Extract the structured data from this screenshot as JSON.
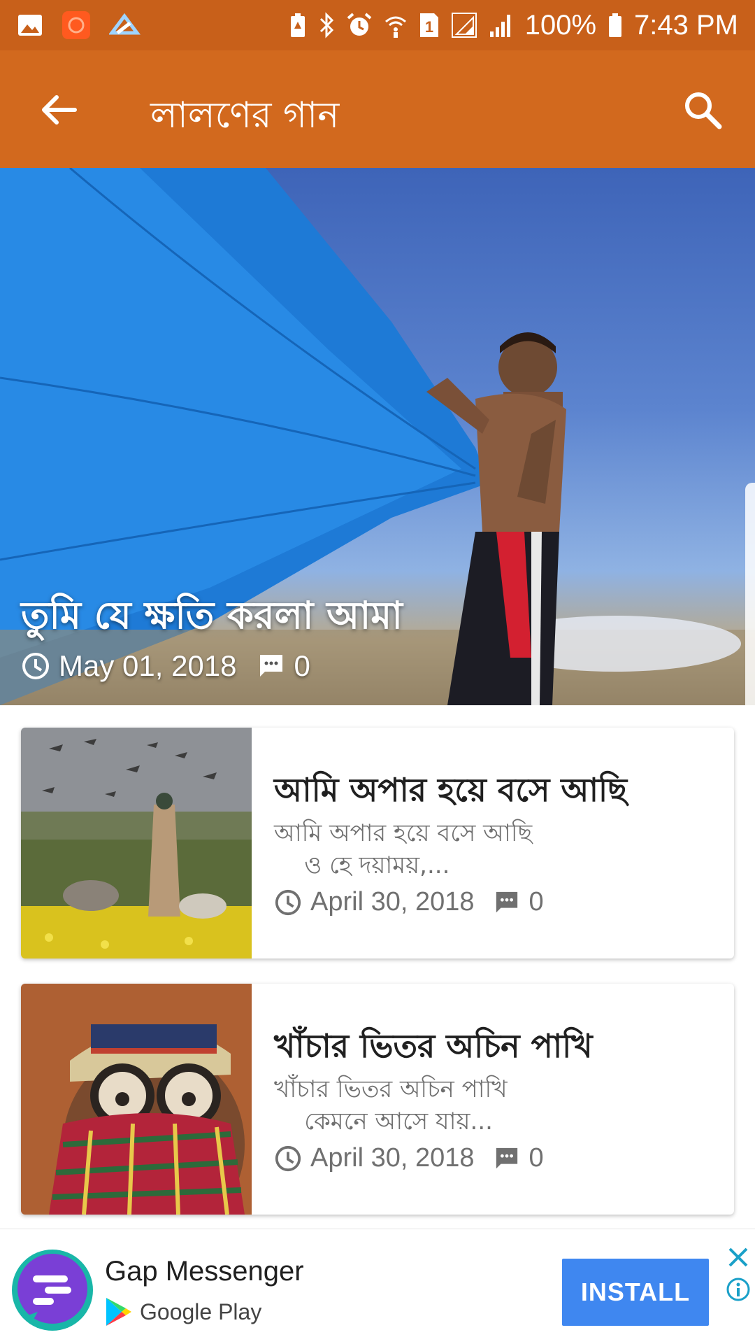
{
  "status_bar": {
    "battery": "100%",
    "time": "7:43 PM",
    "sim_badge": "1"
  },
  "app_bar": {
    "title": "লালণের গান"
  },
  "featured": {
    "title": "তুমি যে ক্ষতি করলা আমা",
    "date": "May 01, 2018",
    "comments": "0"
  },
  "posts": [
    {
      "title": "আমি অপার হয়ে বসে আছি",
      "excerpt": "আমি অপার হয়ে বসে আছি\n    ও হে দয়াময়,...",
      "date": "April 30, 2018",
      "comments": "0"
    },
    {
      "title": "খাঁচার ভিতর অচিন পাখি",
      "excerpt": "খাঁচার ভিতর অচিন পাখি\n    কেমনে আসে যায়...",
      "date": "April 30, 2018",
      "comments": "0"
    }
  ],
  "ad": {
    "app_name": "Gap Messenger",
    "store": "Google Play",
    "install_label": "INSTALL"
  },
  "colors": {
    "status_bar": "#c8601a",
    "app_bar": "#d2691e",
    "install_button": "#3f87f0"
  }
}
